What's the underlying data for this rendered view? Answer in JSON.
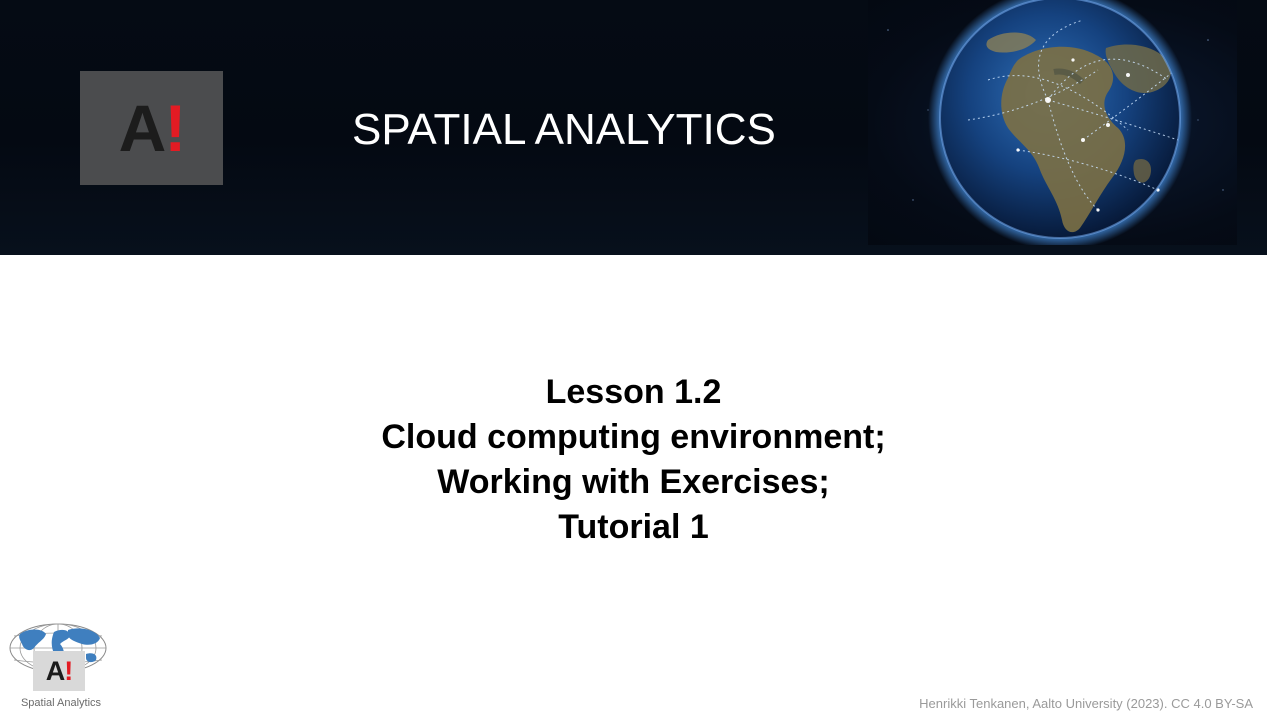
{
  "banner": {
    "logo": {
      "letter": "A",
      "bang": "!"
    },
    "title": "SPATIAL ANALYTICS",
    "image": "earth-globe-network"
  },
  "lesson": {
    "lines": [
      "Lesson 1.2",
      "Cloud computing environment;",
      "Working with Exercises;",
      "Tutorial 1"
    ]
  },
  "footer": {
    "logo": {
      "letter": "A",
      "bang": "!",
      "label": "Spatial Analytics",
      "image": "world-map-globe"
    },
    "credit": "Henrikki Tenkanen, Aalto University (2023). CC 4.0 BY-SA"
  },
  "colors": {
    "banner_bg": "#040912",
    "logo_box": "#4b4c4e",
    "brand_red": "#e31b23",
    "text_dark": "#000000",
    "credit_gray": "#9a9a9a"
  }
}
